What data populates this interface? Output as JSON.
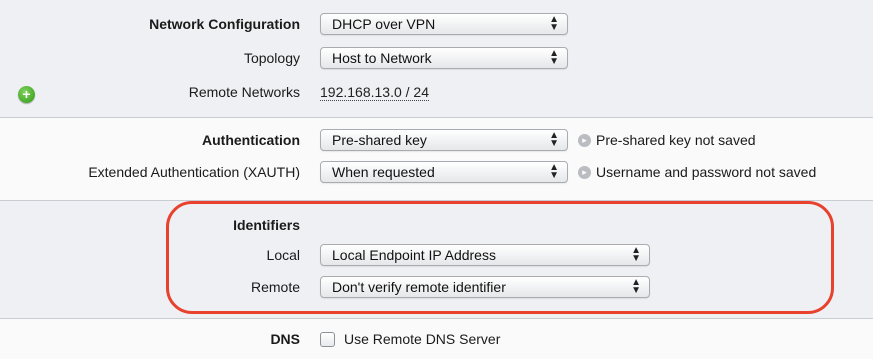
{
  "network": {
    "configuration": {
      "label": "Network Configuration",
      "value": "DHCP over VPN"
    },
    "topology": {
      "label": "Topology",
      "value": "Host to Network"
    },
    "remote_networks": {
      "label": "Remote Networks",
      "value": "192.168.13.0 / 24"
    }
  },
  "auth": {
    "authentication": {
      "label": "Authentication",
      "value": "Pre-shared key",
      "note": "Pre-shared key not saved"
    },
    "xauth": {
      "label": "Extended Authentication (XAUTH)",
      "value": "When requested",
      "note": "Username and password not saved"
    }
  },
  "identifiers": {
    "heading": "Identifiers",
    "local": {
      "label": "Local",
      "value": "Local Endpoint IP Address"
    },
    "remote": {
      "label": "Remote",
      "value": "Don't verify remote identifier"
    }
  },
  "dns": {
    "label": "DNS",
    "checkbox_label": "Use Remote DNS Server",
    "checked": false
  },
  "icons": {
    "add": "plus-circle-icon",
    "info": "arrow-circle-icon",
    "select_arrows": "updown-arrows-icon"
  },
  "colors": {
    "highlight": "#e8412e",
    "add_button": "#2e9a1a"
  }
}
